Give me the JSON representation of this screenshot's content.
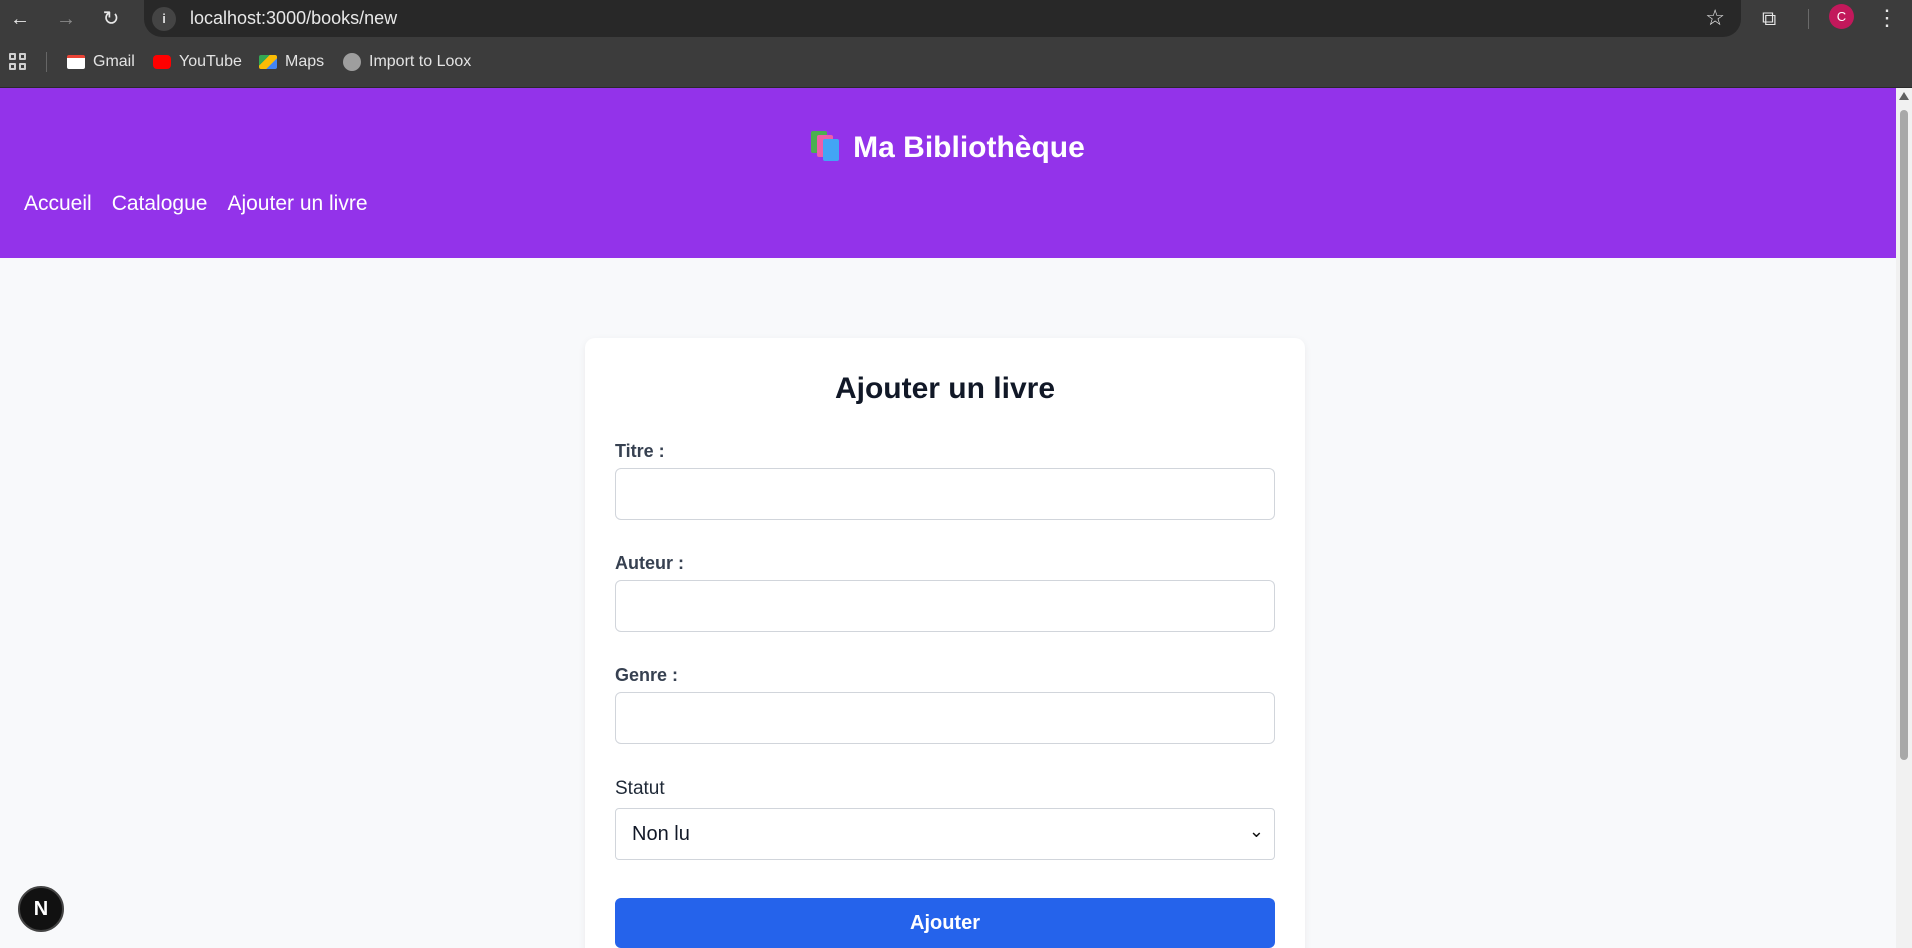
{
  "browser": {
    "url": "localhost:3000/books/new",
    "avatar_letter": "C",
    "bookmarks": [
      {
        "label": "Gmail",
        "icon": "gmail-icon"
      },
      {
        "label": "YouTube",
        "icon": "youtube-icon"
      },
      {
        "label": "Maps",
        "icon": "maps-icon"
      },
      {
        "label": "Import to Loox",
        "icon": "globe-icon"
      }
    ]
  },
  "site": {
    "title": "Ma Bibliothèque",
    "nav": [
      "Accueil",
      "Catalogue",
      "Ajouter un livre"
    ],
    "brand_color": "#9333ea"
  },
  "form": {
    "heading": "Ajouter un livre",
    "titre_label": "Titre :",
    "titre_value": "",
    "auteur_label": "Auteur :",
    "auteur_value": "",
    "genre_label": "Genre :",
    "genre_value": "",
    "statut_label": "Statut",
    "statut_value": "Non lu",
    "submit_label": "Ajouter",
    "submit_color": "#2563eb"
  },
  "dev_badge": "N"
}
